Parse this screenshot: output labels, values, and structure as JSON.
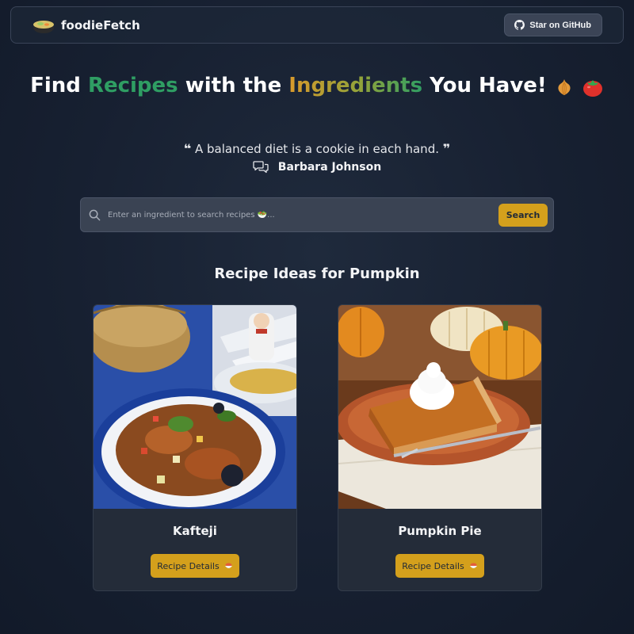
{
  "navbar": {
    "brand_name": "foodieFetch",
    "github_label": "Star on GitHub"
  },
  "hero": {
    "title_part1": "Find ",
    "title_recipes": "Recipes",
    "title_part2": " with the ",
    "title_ingredients": "Ingredients",
    "title_part3": " You Have!",
    "emoji_onion": "🧅",
    "emoji_tomato": "🍅"
  },
  "quote": {
    "open_mark": "❝",
    "text": "A balanced diet is a cookie in each hand.",
    "close_mark": "❞",
    "author": "Barbara Johnson"
  },
  "search": {
    "placeholder": "Enter an ingredient to search recipes 🥗...",
    "button_label": "Search"
  },
  "results": {
    "title": "Recipe Ideas for Pumpkin",
    "cards": [
      {
        "name": "Kafteji",
        "button_label": "Recipe Details"
      },
      {
        "name": "Pumpkin Pie",
        "button_label": "Recipe Details"
      }
    ]
  },
  "colors": {
    "accent": "#d4a01c",
    "green": "#2f9e63",
    "background": "#172031"
  }
}
